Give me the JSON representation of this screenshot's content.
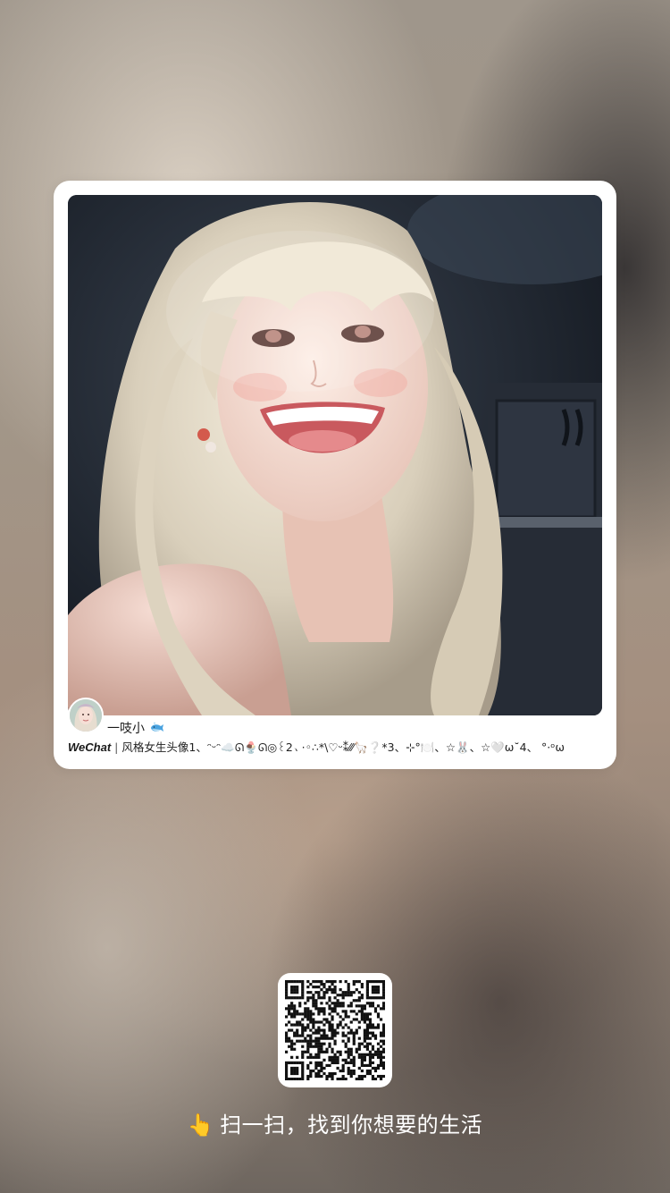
{
  "post": {
    "username": "一吱小",
    "username_icon": "whale-icon",
    "brand": "WeChat",
    "separator": "|",
    "caption": "风格女生头像1、ᵔᵕᵔ☁️ᘏ🍨ᘏ◎꒰2、·◦∴*\\♡ᵕ⁑⁄⁄⁄🦙❔*3、⊹°🍽️、☆🐰、☆🤍ω˘4、 °·ᵒω",
    "avatar_icon": "avatar-girl-photo",
    "photo_icon": "portrait-photo"
  },
  "qr": {
    "icon": "qr-code"
  },
  "scan": {
    "hand": "👆",
    "text": "扫一扫，找到你想要的生活"
  },
  "colors": {
    "card": "#ffffff",
    "hint_text": "#ffffff",
    "caption_text": "#222222"
  }
}
